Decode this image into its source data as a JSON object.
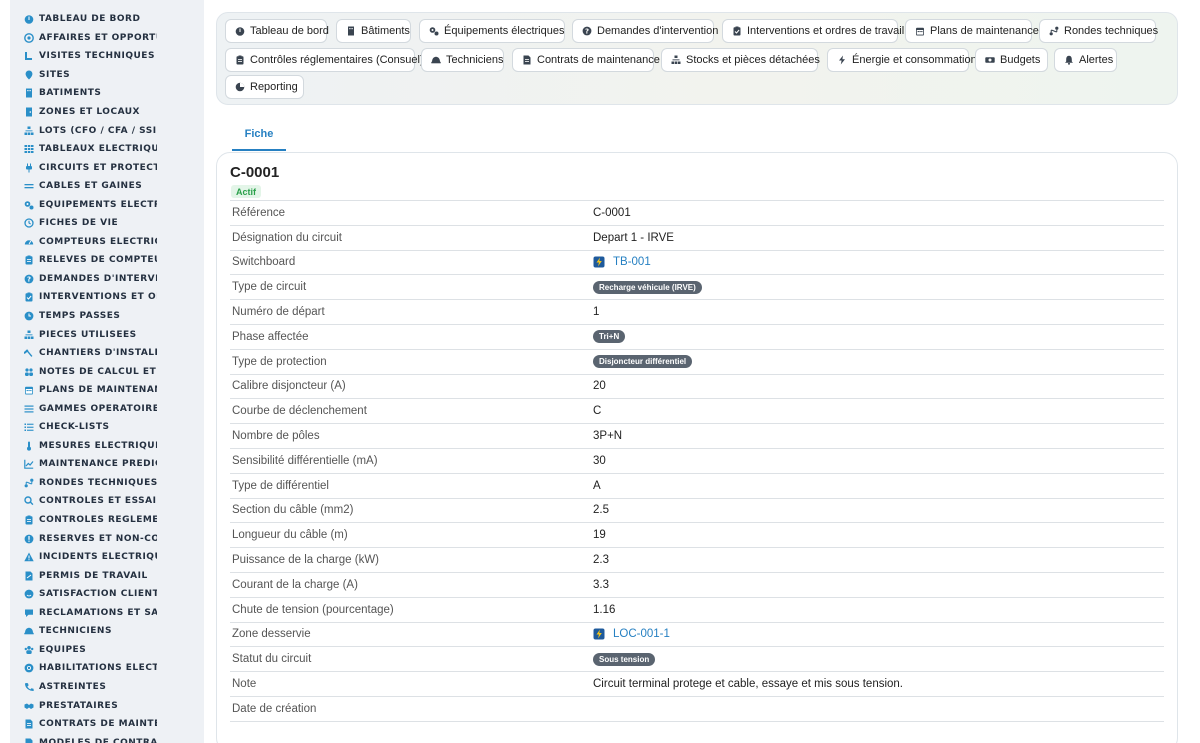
{
  "sidebar": {
    "items": [
      {
        "label": "TABLEAU DE BORD",
        "icon": "dashboard-icon"
      },
      {
        "label": "AFFAIRES ET OPPORTUNITÉS",
        "icon": "target-icon"
      },
      {
        "label": "VISITES TECHNIQUES ET RELEVÉS",
        "icon": "pin-icon"
      },
      {
        "label": "SITES",
        "icon": "map-pin-icon"
      },
      {
        "label": "BÂTIMENTS",
        "icon": "building-icon"
      },
      {
        "label": "ZONES ET LOCAUX",
        "icon": "door-icon"
      },
      {
        "label": "LOTS (CFO / CFA / SSI...)",
        "icon": "sitemap-icon"
      },
      {
        "label": "TABLEAUX ÉLECTRIQUES",
        "icon": "grid-icon"
      },
      {
        "label": "CIRCUITS ET PROTECTIONS",
        "icon": "plug-icon"
      },
      {
        "label": "CÂBLES ET GAINES",
        "icon": "lines-icon"
      },
      {
        "label": "ÉQUIPEMENTS ÉLECTRIQUES",
        "icon": "cogs-icon"
      },
      {
        "label": "FICHES DE VIE",
        "icon": "history-icon"
      },
      {
        "label": "COMPTEURS ÉLECTRIQUES",
        "icon": "gauge-icon"
      },
      {
        "label": "RELEVÉS DE COMPTEURS",
        "icon": "clipboard-icon"
      },
      {
        "label": "DEMANDES D'INTERVENTION",
        "icon": "question-icon"
      },
      {
        "label": "INTERVENTIONS ET ORDRES DE TRAVAIL",
        "icon": "clipboard-check-icon"
      },
      {
        "label": "TEMPS PASSÉS",
        "icon": "clock-icon"
      },
      {
        "label": "PIÈCES UTILISÉES",
        "icon": "sitemap-icon"
      },
      {
        "label": "CHANTIERS D'INSTALLATION",
        "icon": "hammer-icon"
      },
      {
        "label": "NOTES DE CALCUL ET ÉTUDES",
        "icon": "people-icon"
      },
      {
        "label": "PLANS DE MAINTENANCE",
        "icon": "calendar-icon"
      },
      {
        "label": "GAMMES OPÉRATOIRES",
        "icon": "list-icon"
      },
      {
        "label": "CHECK-LISTS",
        "icon": "checklist-icon"
      },
      {
        "label": "MESURES ÉLECTRIQUES",
        "icon": "thermometer-icon"
      },
      {
        "label": "MAINTENANCE PRÉDICTIVE",
        "icon": "chart-line-icon"
      },
      {
        "label": "RONDES TECHNIQUES",
        "icon": "route-icon"
      },
      {
        "label": "CONTRÔLES ET ESSAIS",
        "icon": "search-icon"
      },
      {
        "label": "CONTRÔLES RÉGLEMENTAIRES",
        "icon": "clipboard-icon"
      },
      {
        "label": "RÉSERVES ET NON-CONFORMITÉS",
        "icon": "alert-circle-icon"
      },
      {
        "label": "INCIDENTS ÉLECTRIQUES",
        "icon": "warning-icon"
      },
      {
        "label": "PERMIS DE TRAVAIL",
        "icon": "file-signature-icon"
      },
      {
        "label": "SATISFACTION CLIENT",
        "icon": "smile-icon"
      },
      {
        "label": "RÉCLAMATIONS ET SAV",
        "icon": "comment-icon"
      },
      {
        "label": "TECHNICIENS",
        "icon": "hardhat-icon"
      },
      {
        "label": "ÉQUIPES",
        "icon": "users-icon"
      },
      {
        "label": "HABILITATIONS ÉLECTRIQUES",
        "icon": "certificate-icon"
      },
      {
        "label": "ASTREINTES",
        "icon": "phone-icon"
      },
      {
        "label": "PRESTATAIRES",
        "icon": "handshake-icon"
      },
      {
        "label": "CONTRATS DE MAINTENANCE",
        "icon": "file-contract-icon"
      },
      {
        "label": "MODÈLES DE CONTRATS",
        "icon": "file-icon"
      }
    ]
  },
  "topnav": {
    "buttons": [
      {
        "label": "Tableau de bord",
        "icon": "dashboard-icon"
      },
      {
        "label": "Bâtiments",
        "icon": "building-icon"
      },
      {
        "label": "Équipements électriques",
        "icon": "cogs-icon"
      },
      {
        "label": "Demandes d'intervention",
        "icon": "question-icon"
      },
      {
        "label": "Interventions et ordres de travail",
        "icon": "clipboard-check-icon"
      },
      {
        "label": "Plans de maintenance",
        "icon": "calendar-icon"
      },
      {
        "label": "Rondes techniques",
        "icon": "route-icon"
      },
      {
        "label": "Contrôles réglementaires (Consuel)",
        "icon": "clipboard-icon"
      },
      {
        "label": "Techniciens",
        "icon": "hardhat-icon"
      },
      {
        "label": "Contrats de maintenance",
        "icon": "file-contract-icon"
      },
      {
        "label": "Stocks et pièces détachées",
        "icon": "sitemap-icon"
      },
      {
        "label": "Énergie et consommation",
        "icon": "bolt-icon"
      },
      {
        "label": "Budgets",
        "icon": "money-icon"
      },
      {
        "label": "Alertes",
        "icon": "bell-icon"
      },
      {
        "label": "Reporting",
        "icon": "pie-icon"
      }
    ]
  },
  "tabs": {
    "fiche": "Fiche"
  },
  "record": {
    "title": "C-0001",
    "status": "Actif",
    "fields": [
      {
        "label": "Référence",
        "value": "C-0001",
        "kind": "text"
      },
      {
        "label": "Désignation du circuit",
        "value": "Depart 1 - IRVE",
        "kind": "text"
      },
      {
        "label": "Switchboard",
        "value": "TB-001",
        "kind": "link"
      },
      {
        "label": "Type de circuit",
        "value": "Recharge véhicule (IRVE)",
        "kind": "badge"
      },
      {
        "label": "Numéro de départ",
        "value": "1",
        "kind": "text"
      },
      {
        "label": "Phase affectée",
        "value": "Tri+N",
        "kind": "badge"
      },
      {
        "label": "Type de protection",
        "value": "Disjoncteur différentiel",
        "kind": "badge"
      },
      {
        "label": "Calibre disjoncteur (A)",
        "value": "20",
        "kind": "text"
      },
      {
        "label": "Courbe de déclenchement",
        "value": "C",
        "kind": "text"
      },
      {
        "label": "Nombre de pôles",
        "value": "3P+N",
        "kind": "text"
      },
      {
        "label": "Sensibilité différentielle (mA)",
        "value": "30",
        "kind": "text"
      },
      {
        "label": "Type de différentiel",
        "value": "A",
        "kind": "text"
      },
      {
        "label": "Section du câble (mm2)",
        "value": "2.5",
        "kind": "text"
      },
      {
        "label": "Longueur du câble (m)",
        "value": "19",
        "kind": "text"
      },
      {
        "label": "Puissance de la charge (kW)",
        "value": "2.3",
        "kind": "text"
      },
      {
        "label": "Courant de la charge (A)",
        "value": "3.3",
        "kind": "text"
      },
      {
        "label": "Chute de tension (pourcentage)",
        "value": "1.16",
        "kind": "text"
      },
      {
        "label": "Zone desservie",
        "value": "LOC-001-1",
        "kind": "link"
      },
      {
        "label": "Statut du circuit",
        "value": "Sous tension",
        "kind": "badge"
      },
      {
        "label": "Note",
        "value": "Circuit terminal protege et cable, essaye et mis sous tension.",
        "kind": "text"
      },
      {
        "label": "Date de création",
        "value": "",
        "kind": "text"
      }
    ]
  },
  "colors": {
    "accent": "#2680c2",
    "sidebar_icon": "#2a8fc8",
    "status_green": "#2aa04a",
    "badge_gray": "#5a6470"
  }
}
